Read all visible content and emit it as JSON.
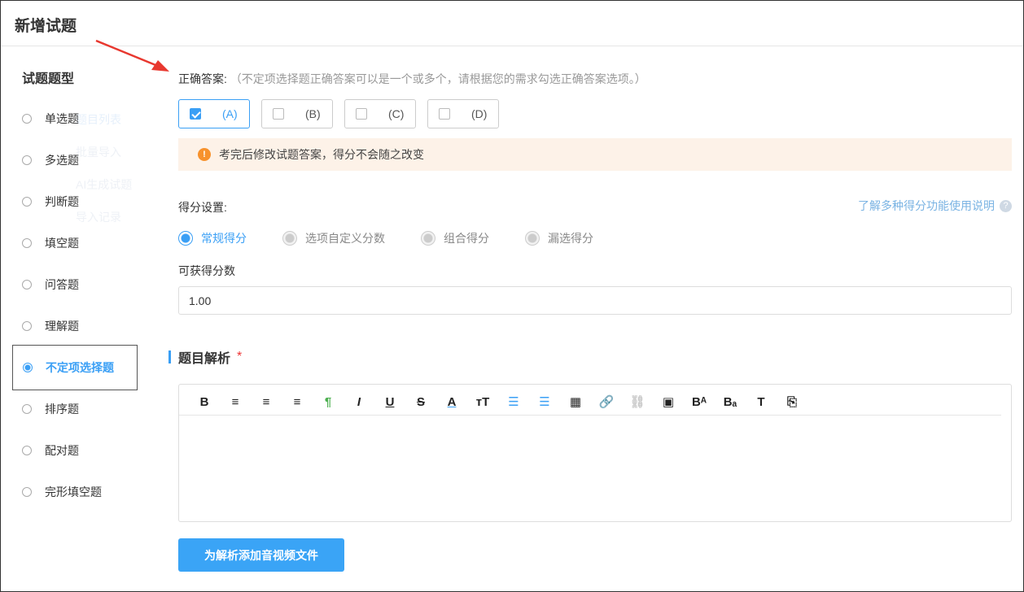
{
  "header": {
    "title": "新增试题"
  },
  "sidebar": {
    "title": "试题题型",
    "ghost_menu": [
      "题目列表",
      "批量导入",
      "AI生成试题",
      "导入记录"
    ],
    "types": [
      {
        "label": "单选题"
      },
      {
        "label": "多选题"
      },
      {
        "label": "判断题"
      },
      {
        "label": "填空题"
      },
      {
        "label": "问答题"
      },
      {
        "label": "理解题"
      },
      {
        "label": "不定项选择题",
        "active": true
      },
      {
        "label": "排序题"
      },
      {
        "label": "配对题"
      },
      {
        "label": "完形填空题"
      }
    ]
  },
  "answer": {
    "label": "正确答案:",
    "hint": "（不定项选择题正确答案可以是一个或多个，请根据您的需求勾选正确答案选项。）",
    "options": [
      {
        "label": "(A)",
        "checked": true
      },
      {
        "label": "(B)",
        "checked": false
      },
      {
        "label": "(C)",
        "checked": false
      },
      {
        "label": "(D)",
        "checked": false
      }
    ]
  },
  "warning": {
    "icon": "exclamation-icon",
    "text": "考完后修改试题答案，得分不会随之改变"
  },
  "scoring": {
    "label": "得分设置:",
    "help_link": "了解多种得分功能使用说明",
    "modes": [
      {
        "label": "常规得分",
        "selected": true
      },
      {
        "label": "选项自定义分数"
      },
      {
        "label": "组合得分"
      },
      {
        "label": "漏选得分"
      }
    ],
    "score_label": "可获得分数",
    "score_value": "1.00"
  },
  "analysis": {
    "title": "题目解析",
    "required": "*",
    "toolbar": [
      "B",
      "≡",
      "≡",
      "≡",
      "¶",
      "I",
      "U",
      "S",
      "A",
      "тT",
      "☰",
      "☰",
      "▦",
      "🔗",
      "⛓",
      "▣",
      "Bᴬ",
      "Bₐ",
      "T",
      "⎘"
    ],
    "toolbar_names": [
      "bold",
      "align-left",
      "align-center",
      "align-right",
      "paragraph",
      "italic",
      "underline",
      "strikethrough",
      "font-color",
      "font-size",
      "ordered-list",
      "unordered-list",
      "table",
      "link",
      "unlink",
      "image",
      "superscript",
      "subscript",
      "text-box",
      "html-source"
    ],
    "upload_button": "为解析添加音视频文件"
  },
  "colors": {
    "accent": "#3a9ff5",
    "warning_bg": "#fdf2e8",
    "warning_icon": "#f7922d",
    "arrow": "#e8382f"
  }
}
